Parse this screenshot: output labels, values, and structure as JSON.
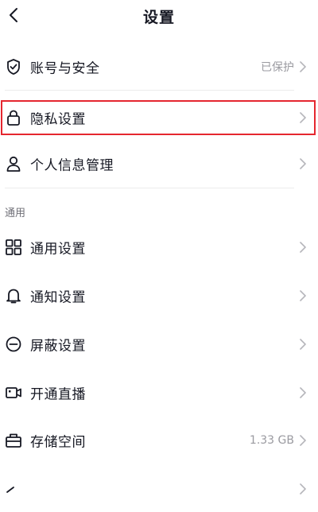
{
  "header": {
    "title": "设置",
    "back_icon": "chevron-left-icon"
  },
  "account_group": [
    {
      "label": "账号与安全",
      "value": "已保护",
      "icon": "shield-check-icon"
    },
    {
      "label": "隐私设置",
      "value": "",
      "icon": "lock-icon"
    },
    {
      "label": "个人信息管理",
      "value": "",
      "icon": "person-icon"
    }
  ],
  "general_section": {
    "title": "通用",
    "items": [
      {
        "label": "通用设置",
        "value": "",
        "icon": "grid-icon"
      },
      {
        "label": "通知设置",
        "value": "",
        "icon": "bell-icon"
      },
      {
        "label": "屏蔽设置",
        "value": "",
        "icon": "block-icon"
      },
      {
        "label": "开通直播",
        "value": "",
        "icon": "video-camera-icon"
      },
      {
        "label": "存储空间",
        "value": "1.33 GB",
        "icon": "storage-box-icon"
      }
    ]
  },
  "colors": {
    "text": "#161823",
    "muted": "#9a9aa0",
    "highlight": "#e5262f"
  }
}
